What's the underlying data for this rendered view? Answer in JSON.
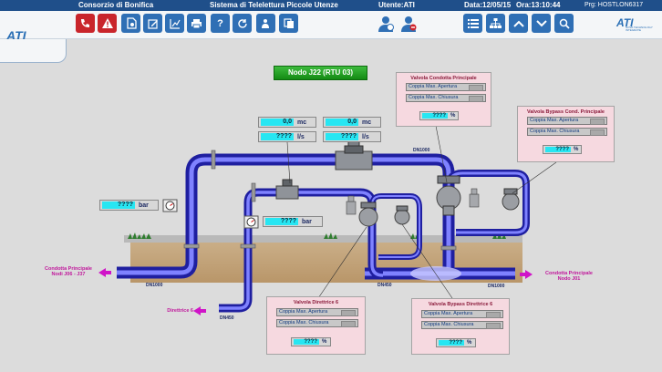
{
  "header": {
    "org": "Consorzio di Bonifica",
    "system": "Sistema di Telelettura Piccole Utenze",
    "user_label": "Utente:ATI",
    "date_label": "Data:12/05/15",
    "time_label": "Ora:13:10:44",
    "prog_label": "Prg: HOSTLON6317"
  },
  "toolbar": {
    "left_icons": [
      "phone-icon",
      "alarm-icon",
      "report-icon",
      "edit-icon",
      "chart-icon",
      "print-icon",
      "help-icon",
      "refresh-icon",
      "user-info-icon",
      "copy-icon"
    ],
    "right_icons": [
      "user-config-icon",
      "user-remove-icon",
      "list-icon",
      "tree-icon",
      "chevron-up-icon",
      "chevron-down-icon",
      "search-icon"
    ]
  },
  "logo": {
    "text": "ATI",
    "sub": "NOVA TECHNOLOGY INTEGRATE"
  },
  "node_title": "Nodo J22 (RTU 03)",
  "meters": [
    {
      "value": "0,0",
      "unit": "mc"
    },
    {
      "value": "????",
      "unit": "l/s"
    },
    {
      "value": "0,0",
      "unit": "mc"
    },
    {
      "value": "????",
      "unit": "l/s"
    }
  ],
  "pressure_left": {
    "value": "????",
    "unit": "bar"
  },
  "pressure_center": {
    "value": "????",
    "unit": "bar"
  },
  "panels": {
    "main_valve": {
      "title": "Valvola Condotta Principale",
      "rows": [
        "Coppia Max. Apertura",
        "Coppia Max. Chiusura"
      ],
      "value": "????",
      "unit": "%"
    },
    "bypass_main": {
      "title": "Valvola Bypass Cond. Principale",
      "rows": [
        "Coppia Max. Apertura",
        "Coppia Max. Chiusura"
      ],
      "value": "????",
      "unit": "%"
    },
    "directrix": {
      "title": "Valvola Direttrice 6",
      "rows": [
        "Coppia Max. Apertura",
        "Coppia Max. Chiusura"
      ],
      "value": "????",
      "unit": "%"
    },
    "bypass_directrix": {
      "title": "Valvola Bypass Direttrice 6",
      "rows": [
        "Coppia Max. Apertura",
        "Coppia Max. Chiusura"
      ],
      "value": "????",
      "unit": "%"
    }
  },
  "pipe_labels": {
    "dn1000_top": "DN1000",
    "dn1000_left": "DN1000",
    "dn1000_right": "DN1000",
    "dn450_bottom": "DN450",
    "dn450_mid": "DN450"
  },
  "connections": {
    "left_line1": "Condotta Principale",
    "left_line2": "Nodi J06 - J37",
    "right_line1": "Condotta Principale",
    "right_line2": "Nodo J01",
    "directrix": "Direttrice 6"
  },
  "colors": {
    "titlebar": "#1f4f8a",
    "pipe": "#3d3ee0",
    "node_title": "#1f9e1f",
    "value_field": "#27e6f2",
    "panel": "#f6d9e0",
    "arrow": "#d014c8"
  }
}
